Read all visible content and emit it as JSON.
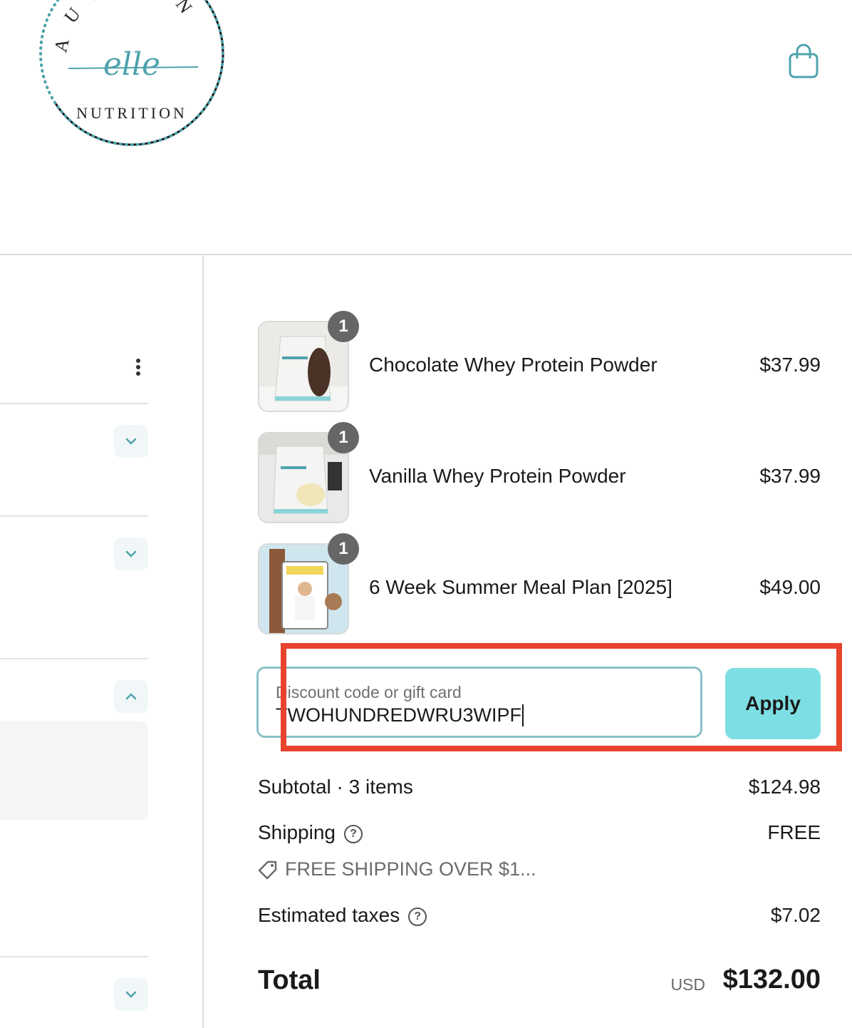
{
  "brand": {
    "logo_top_text": "AUTUMN",
    "logo_script_text": "elle",
    "logo_bottom_text": "NUTRITION",
    "accent_color": "#4fa3ad"
  },
  "header": {
    "cart_icon": "shopping-bag-icon"
  },
  "left_column": {
    "menu_icon": "kebab-menu-icon",
    "chevrons": [
      "chevron-down-icon",
      "chevron-down-icon",
      "chevron-up-icon",
      "chevron-down-icon"
    ]
  },
  "order": {
    "items": [
      {
        "name": "Chocolate Whey Protein Powder",
        "price": "$37.99",
        "qty": "1"
      },
      {
        "name": "Vanilla Whey Protein Powder",
        "price": "$37.99",
        "qty": "1"
      },
      {
        "name": "6 Week Summer Meal Plan [2025]",
        "price": "$49.00",
        "qty": "1"
      }
    ],
    "discount": {
      "label": "Discount code or gift card",
      "value": "TWOHUNDREDWRU3WIPF",
      "apply_label": "Apply"
    },
    "subtotal_label": "Subtotal · 3 items",
    "subtotal_value": "$124.98",
    "shipping_label": "Shipping",
    "shipping_value": "FREE",
    "promo_text": "FREE SHIPPING OVER $1...",
    "taxes_label": "Estimated taxes",
    "taxes_value": "$7.02",
    "total_label": "Total",
    "total_currency": "USD",
    "total_value": "$132.00"
  },
  "annotation_color": "#e8432d"
}
